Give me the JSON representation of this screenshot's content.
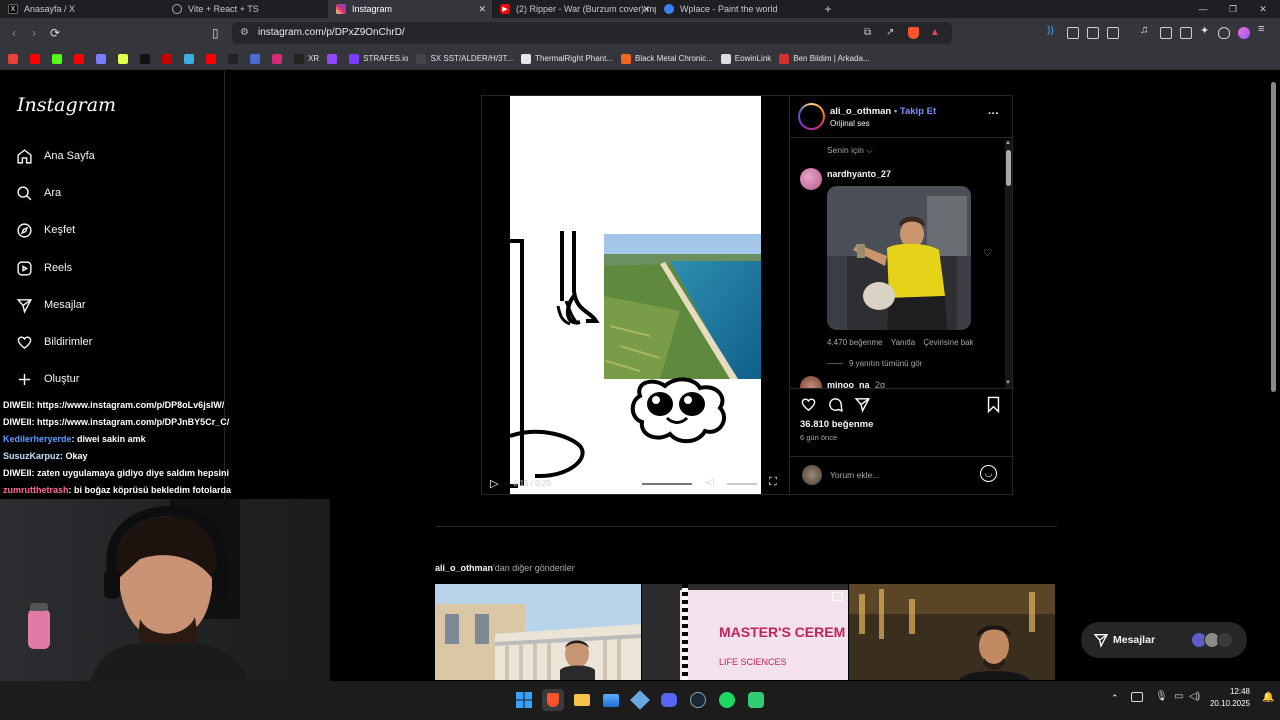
{
  "browser": {
    "tabs": [
      {
        "label": "Anasayfa / X",
        "icon": "x-logo-icon",
        "color": "#000000",
        "active": false
      },
      {
        "label": "Vite + React + TS",
        "icon": "globe-icon",
        "color": "#555555",
        "active": false
      },
      {
        "label": "Instagram",
        "icon": "instagram-icon",
        "color": "#d62976",
        "active": true,
        "close": "✕"
      },
      {
        "label": "(2) Ripper - War (Burzum cover).mp4",
        "icon": "youtube-icon",
        "color": "#ff0000",
        "active": false,
        "close": "✕"
      },
      {
        "label": "Wplace - Paint the world",
        "icon": "globe-icon",
        "color": "#3b82f6",
        "active": false
      }
    ],
    "new_tab": "+",
    "url": "instagram.com/p/DPxZ9OnChrD/",
    "bookmarks": [
      {
        "label": "",
        "color": "#ea4335"
      },
      {
        "label": "",
        "color": "#ff0000"
      },
      {
        "label": "",
        "color": "#53fc18"
      },
      {
        "label": "",
        "color": "#ff0000"
      },
      {
        "label": "",
        "color": "#7c7cff"
      },
      {
        "label": "",
        "color": "#e6ff4c"
      },
      {
        "label": "",
        "color": "#111111"
      },
      {
        "label": "",
        "color": "#cc0000"
      },
      {
        "label": "",
        "color": "#3ab0e2"
      },
      {
        "label": "",
        "color": "#ff0000"
      },
      {
        "label": "",
        "color": "#222222"
      },
      {
        "label": "",
        "color": "#4a6cd4"
      },
      {
        "label": "",
        "color": "#d62976"
      },
      {
        "label": "XR",
        "color": "#222222"
      },
      {
        "label": "",
        "color": "#9146ff"
      },
      {
        "label": "STRAFES.io",
        "color": "#7a3cff"
      },
      {
        "label": "SX SST/ALDER/H/3T...",
        "color": "#444444"
      },
      {
        "label": "ThermalRight Phant...",
        "color": "#e6e6e6"
      },
      {
        "label": "Black Metal Chronic...",
        "color": "#f26522"
      },
      {
        "label": "EowinLink",
        "color": "#dddddd"
      },
      {
        "label": "Ben Bildim | Arkada...",
        "color": "#d32f2f"
      }
    ]
  },
  "ig": {
    "logo": "Instagram",
    "nav": [
      {
        "label": "Ana Sayfa",
        "icon": "home-icon"
      },
      {
        "label": "Ara",
        "icon": "search-icon"
      },
      {
        "label": "Keşfet",
        "icon": "compass-icon"
      },
      {
        "label": "Reels",
        "icon": "reels-icon"
      },
      {
        "label": "Mesajlar",
        "icon": "send-icon"
      },
      {
        "label": "Bildirimler",
        "icon": "heart-icon"
      },
      {
        "label": "Oluştur",
        "icon": "plus-icon"
      }
    ],
    "post": {
      "username": "ali_o_othman",
      "sep": "•",
      "follow": "Takip Et",
      "audio": "Orijinal ses",
      "more": "···",
      "sort": "Senin için",
      "comment_user": "nardhyanto_27",
      "comment_likes": "4.470 beğenme",
      "reply": "Yanıtla",
      "translate": "Çevirisine bak",
      "view_replies": "9 yanıtın tümünü gör",
      "next_user": "minoo_na",
      "next_time": "2g",
      "likes": "36.810 beğenme",
      "time": "6 gün önce",
      "comment_placeholder": "Yorum ekle...",
      "video_time": "0:15 / 0:25",
      "video_progress": 0.6
    },
    "more_from_user": "ali_o_othman",
    "more_from_suffix": "'dan diğer gönderiler",
    "thumb_text_1": "MASTER'S CEREM",
    "thumb_text_2": "LIFE SCIENCES",
    "messages_label": "Mesajlar"
  },
  "chat": [
    {
      "user": "DIWEII",
      "color": "#ffffff",
      "msg": ": https://www.instagram.com/p/DP8oLv6jsIW/"
    },
    {
      "user": "DIWEII",
      "color": "#ffffff",
      "msg": ": https://www.instagram.com/p/DPJnBY5Cr_C/"
    },
    {
      "user": "Kedilerheryerde",
      "color": "#5b9bff",
      "msg": ": diwei sakin amk"
    },
    {
      "user": "SusuzKarpuz",
      "color": "#bfe0ff",
      "msg": ": Okay"
    },
    {
      "user": "DIWEII",
      "color": "#ffffff",
      "msg": ": zaten uygulamaya gidiyo diye saldım hepsini"
    },
    {
      "user": "zumrutthetrash",
      "color": "#ff6b9a",
      "msg": ": bi boğaz köprüsü bekledim fotolarda"
    }
  ],
  "taskbar": {
    "time": "12:48",
    "date": "20.10.2025"
  }
}
